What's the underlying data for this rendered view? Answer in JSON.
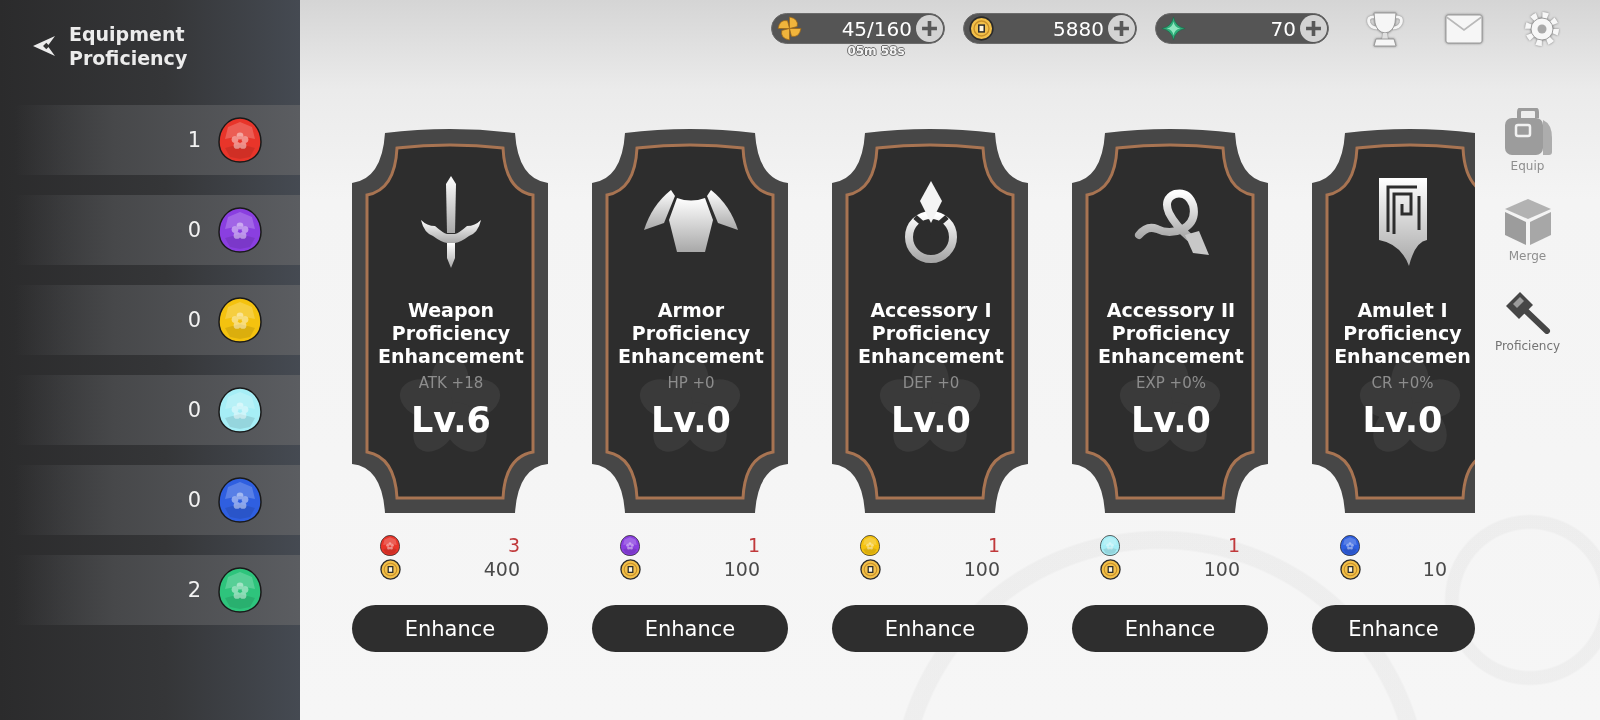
{
  "sidebar": {
    "title": "Equipment Proficiency",
    "gems": [
      {
        "count": "1",
        "color": "#e8352a"
      },
      {
        "count": "0",
        "color": "#8a3fe0"
      },
      {
        "count": "0",
        "color": "#f4c20f"
      },
      {
        "count": "0",
        "color": "#a6eef6"
      },
      {
        "count": "0",
        "color": "#2f5fe0"
      },
      {
        "count": "2",
        "color": "#2ec47c"
      }
    ]
  },
  "currencies": [
    {
      "kind": "stamina",
      "value": "45/160",
      "timer": "05m 58s"
    },
    {
      "kind": "coin",
      "value": "5880"
    },
    {
      "kind": "crystal",
      "value": "70"
    }
  ],
  "cards": [
    {
      "kind": "weapon",
      "title": "Weapon Proficiency Enhancement",
      "stat": "ATK +18",
      "level_text": "Lv.6",
      "costs": [
        {
          "kind": "gem",
          "color": "#e8352a",
          "amount": "3",
          "insufficient": true
        },
        {
          "kind": "coin",
          "amount": "400",
          "insufficient": false
        }
      ],
      "button": "Enhance"
    },
    {
      "kind": "armor",
      "title": "Armor Proficiency Enhancement",
      "stat": "HP +0",
      "level_text": "Lv.0",
      "costs": [
        {
          "kind": "gem",
          "color": "#8a3fe0",
          "amount": "1",
          "insufficient": true
        },
        {
          "kind": "coin",
          "amount": "100",
          "insufficient": false
        }
      ],
      "button": "Enhance"
    },
    {
      "kind": "ring",
      "title": "Accessory I Proficiency Enhancement",
      "stat": "DEF +0",
      "level_text": "Lv.0",
      "costs": [
        {
          "kind": "gem",
          "color": "#f4c20f",
          "amount": "1",
          "insufficient": true
        },
        {
          "kind": "coin",
          "amount": "100",
          "insufficient": false
        }
      ],
      "button": "Enhance"
    },
    {
      "kind": "scarf",
      "title": "Accessory II Proficiency Enhancement",
      "stat": "EXP +0%",
      "level_text": "Lv.0",
      "costs": [
        {
          "kind": "gem",
          "color": "#a6eef6",
          "amount": "1",
          "insufficient": true
        },
        {
          "kind": "coin",
          "amount": "100",
          "insufficient": false
        }
      ],
      "button": "Enhance"
    },
    {
      "kind": "amulet",
      "title": "Amulet I Proficiency Enhancemen",
      "stat": "CR +0%",
      "level_text": "Lv.0",
      "costs": [
        {
          "kind": "gem",
          "color": "#2f5fe0"
        },
        {
          "kind": "coin",
          "amount": "10",
          "insufficient": false
        }
      ],
      "button": "Enhance"
    }
  ],
  "nav": [
    {
      "kind": "equip",
      "label": "Equip",
      "selected": false
    },
    {
      "kind": "merge",
      "label": "Merge",
      "selected": false
    },
    {
      "kind": "proficiency",
      "label": "Proficiency",
      "selected": true
    }
  ]
}
